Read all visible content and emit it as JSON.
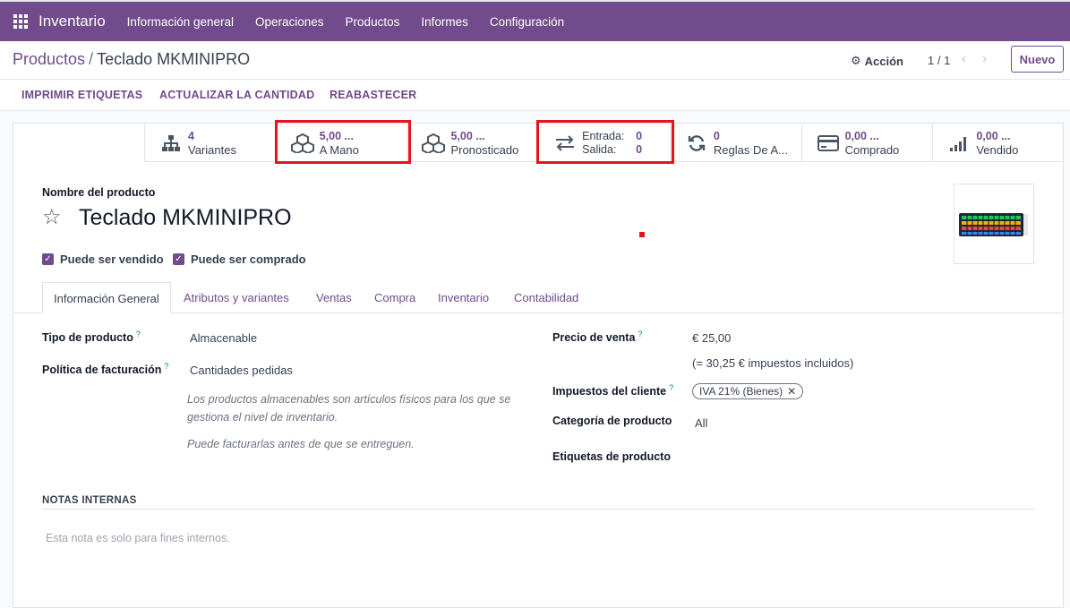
{
  "topbar": {
    "app_name": "Inventario",
    "menu": [
      "Información general",
      "Operaciones",
      "Productos",
      "Informes",
      "Configuración"
    ]
  },
  "control": {
    "breadcrumb_parent": "Productos",
    "breadcrumb_sep": "/",
    "breadcrumb_current": "Teclado MKMINIPRO",
    "action_label": "Acción",
    "pager": "1 / 1",
    "new_button": "Nuevo"
  },
  "actions": {
    "print_labels": "IMPRIMIR ETIQUETAS",
    "update_qty": "ACTUALIZAR LA CANTIDAD",
    "replenish": "REABASTECER"
  },
  "smart_buttons": {
    "variants": {
      "value": "4",
      "label": "Variantes"
    },
    "on_hand": {
      "value": "5,00 ...",
      "label": "A Mano"
    },
    "forecasted": {
      "value": "5,00 ...",
      "label": "Pronosticado"
    },
    "in_out": {
      "in_label": "Entrada:",
      "in_value": "0",
      "out_label": "Salida:",
      "out_value": "0"
    },
    "rules": {
      "value": "0",
      "label": "Reglas De A..."
    },
    "purchased": {
      "value": "0,00 ...",
      "label": "Comprado"
    },
    "sold": {
      "value": "0,00 ...",
      "label": "Vendido"
    }
  },
  "form": {
    "name_label": "Nombre del producto",
    "name": "Teclado MKMINIPRO",
    "can_be_sold": "Puede ser vendido",
    "can_be_purchased": "Puede ser comprado"
  },
  "tabs": [
    "Información General",
    "Atributos y variantes",
    "Ventas",
    "Compra",
    "Inventario",
    "Contabilidad"
  ],
  "general": {
    "type_label": "Tipo de producto",
    "type_value": "Almacenable",
    "invoice_policy_label": "Política de facturación",
    "invoice_policy_value": "Cantidades pedidas",
    "note1": "Los productos almacenables son artículos físicos para los que se gestiona el nivel de inventario.",
    "note2": "Puede facturarlas antes de que se entreguen.",
    "sale_price_label": "Precio de venta",
    "sale_price_value": "€ 25,00",
    "sale_price_taxed": "(= 30,25 € impuestos incluidos)",
    "customer_taxes_label": "Impuestos del cliente",
    "customer_tax_tag": "IVA 21% (Bienes)",
    "category_label": "Categoría de producto",
    "category_value": "All",
    "tags_label": "Etiquetas de producto",
    "help_marker": "?"
  },
  "notes": {
    "title": "NOTAS INTERNAS",
    "placeholder": "Esta nota es solo para fines internos."
  },
  "colors": {
    "brand": "#714b8b",
    "highlight": "#e8141c"
  }
}
